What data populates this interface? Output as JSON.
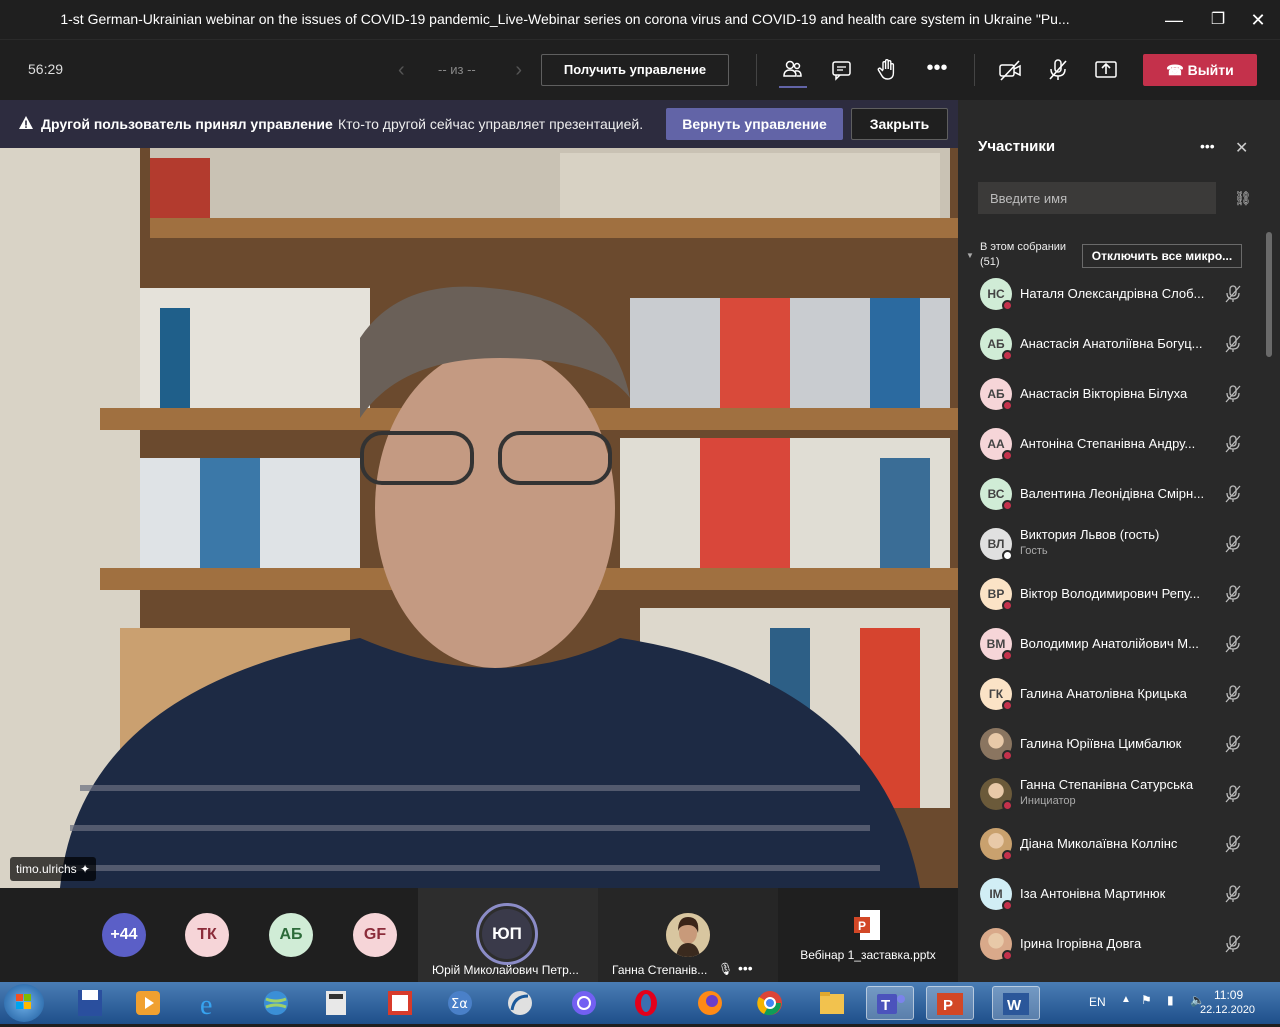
{
  "window": {
    "title": "1-st German-Ukrainian webinar on the issues of COVID-19 pandemic_Live-Webinar series on corona virus and COVID-19 and health care system in Ukraine \"Pu...",
    "controls": {
      "minimize": "—",
      "maximize": "❐",
      "close": "✕"
    }
  },
  "toolbar": {
    "timer": "56:29",
    "pager_text": "-- из --",
    "take_control": "Получить управление",
    "leave": "Выйти",
    "icons": [
      "people-icon",
      "chat-icon",
      "raise-hand-icon",
      "more-icon",
      "camera-off-icon",
      "mic-off-icon",
      "share-icon"
    ]
  },
  "banner": {
    "title": "Другой пользователь принял управление",
    "text": "Кто-то другой сейчас управляет презентацией.",
    "take_back": "Вернуть управление",
    "close": "Закрыть"
  },
  "video": {
    "name_tag": "timo.ulrichs"
  },
  "strip": {
    "overflow_count": "+44",
    "avatars": [
      {
        "initials": "ТК",
        "bg": "#f6d5d8",
        "fg": "#8b2c3a"
      },
      {
        "initials": "АБ",
        "bg": "#d0ecd6",
        "fg": "#2d6b3a"
      },
      {
        "initials": "GF",
        "bg": "#f6d5d8",
        "fg": "#8b2c3a"
      }
    ],
    "presenter": {
      "initials": "ЮП",
      "name": "Юрій Миколайович Петр..."
    },
    "tile2_name": "Ганна Степанів...",
    "file_name": "Вебінар 1_заставка.pptx"
  },
  "panel": {
    "title": "Участники",
    "search_placeholder": "Введите имя",
    "section_label": "В этом собрании",
    "section_count": "(51)",
    "mute_all": "Отключить все микро...",
    "participants": [
      {
        "initials": "НС",
        "name": "Наталя Олександрівна Слоб...",
        "sub": "",
        "bg": "#d0ecd6"
      },
      {
        "initials": "АБ",
        "name": "Анастасія Анатоліївна Богуц...",
        "sub": "",
        "bg": "#d0ecd6"
      },
      {
        "initials": "АБ",
        "name": "Анастасія Вікторівна Білуха",
        "sub": "",
        "bg": "#f6d5d8"
      },
      {
        "initials": "АА",
        "name": "Антоніна Степанівна Андру...",
        "sub": "",
        "bg": "#f6d5d8"
      },
      {
        "initials": "ВС",
        "name": "Валентина Леонідівна Смірн...",
        "sub": "",
        "bg": "#d0ecd6"
      },
      {
        "initials": "ВЛ",
        "name": "Виктория Львов (гость)",
        "sub": "Гость",
        "bg": "#e0e0e0"
      },
      {
        "initials": "ВР",
        "name": "Віктор Володимирович Репу...",
        "sub": "",
        "bg": "#fbe3c6"
      },
      {
        "initials": "ВМ",
        "name": "Володимир Анатолійович М...",
        "sub": "",
        "bg": "#f6d5d8"
      },
      {
        "initials": "ГК",
        "name": "Галина Анатолівна Крицька",
        "sub": "",
        "bg": "#fbe3c6"
      },
      {
        "initials": "",
        "name": "Галина Юріївна Цимбалюк",
        "sub": "",
        "bg": "#8a7560"
      },
      {
        "initials": "",
        "name": "Ганна Степанівна Сатурська",
        "sub": "Инициатор",
        "bg": "#6b5a3a"
      },
      {
        "initials": "",
        "name": "Діана Миколаївна Коллінс",
        "sub": "",
        "bg": "#c9a16e"
      },
      {
        "initials": "ІМ",
        "name": "Іза Антонівна Мартинюк",
        "sub": "",
        "bg": "#d1eef5"
      },
      {
        "initials": "",
        "name": "Ірина Ігорівна Довга",
        "sub": "",
        "bg": "#d9a98a"
      }
    ]
  },
  "taskbar": {
    "lang": "EN",
    "time": "11:09",
    "date": "22.12.2020"
  }
}
